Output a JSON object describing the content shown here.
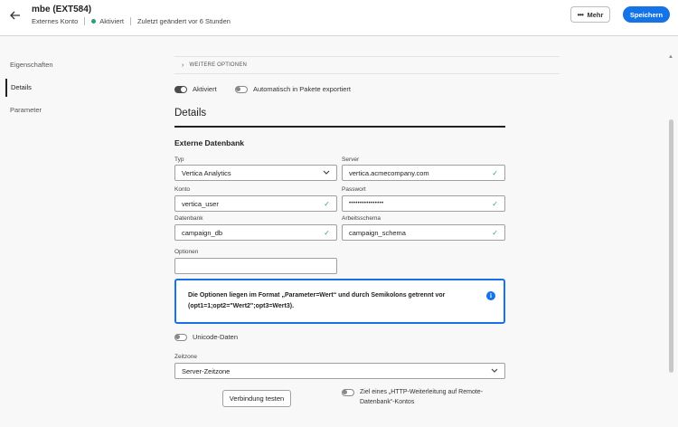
{
  "header": {
    "title": "mbe (EXT584)",
    "subtitle_type": "Externes Konto",
    "status": "Aktiviert",
    "modified": "Zuletzt geändert vor 6 Stunden",
    "more_label": "Mehr",
    "save_label": "Speichern"
  },
  "sidebar": {
    "items": [
      {
        "label": "Eigenschaften"
      },
      {
        "label": "Details"
      },
      {
        "label": "Parameter"
      }
    ]
  },
  "main": {
    "weitere_optionen": "WEITERE OPTIONEN",
    "toggles": {
      "activated": {
        "label": "Aktiviert",
        "on": true
      },
      "auto_export": {
        "label": "Automatisch in Pakete exportiert",
        "on": false
      }
    },
    "details_title": "Details",
    "db_title": "Externe Datenbank",
    "fields": {
      "typ": {
        "label": "Typ",
        "value": "Vertica Analytics"
      },
      "server": {
        "label": "Server",
        "value": "vertica.acmecompany.com"
      },
      "konto": {
        "label": "Konto",
        "value": "vertica_user"
      },
      "passwort": {
        "label": "Passwort",
        "value": "••••••••••••••••"
      },
      "datenbank": {
        "label": "Datenbank",
        "value": "campaign_db"
      },
      "arbeitsschema": {
        "label": "Arbeitsschema",
        "value": "campaign_schema"
      },
      "optionen": {
        "label": "Optionen",
        "value": ""
      }
    },
    "info_text": "Die Optionen liegen im Format „Parameter=Wert“ und durch Semikolons getrennt vor (opt1=1;opt2=\"Wert2\";opt3=Wert3).",
    "unicode_label": "Unicode-Daten",
    "zeitzone": {
      "label": "Zeitzone",
      "value": "Server-Zeitzone"
    },
    "test_button": "Verbindung testen",
    "http_label": "Ziel eines „HTTP-Weiterleitung auf Remote-Datenbank“-Kontos"
  },
  "colors": {
    "accent": "#1473e6",
    "success": "#2d9d78"
  },
  "icons": [
    "back-arrow-icon",
    "more-dots-icon",
    "chevron-right-icon",
    "chevron-down-icon",
    "checkmark-icon",
    "info-icon"
  ]
}
